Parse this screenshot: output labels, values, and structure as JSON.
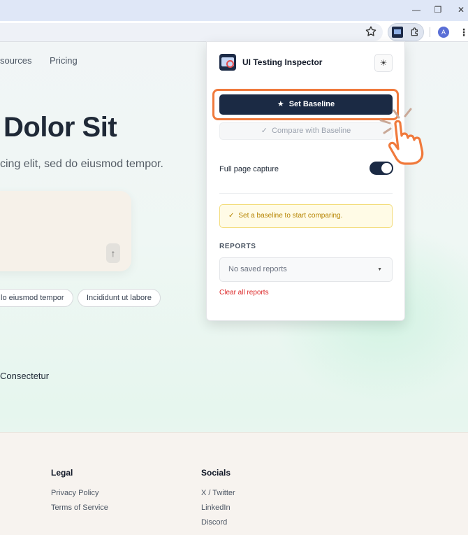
{
  "browser": {
    "window_controls": {
      "minimize": "—",
      "restore": "❐",
      "close": "✕"
    },
    "avatar_letter": "A"
  },
  "site": {
    "nav": [
      "sources",
      "Pricing"
    ],
    "hero_title": "Dolor Sit",
    "hero_subtitle": "cing elit, sed do eiusmod tempor.",
    "send_glyph": "↑",
    "chips": [
      "lo eiusmod tempor",
      "Incididunt ut labore"
    ],
    "link_text": "Consectetur",
    "footer": {
      "legal": {
        "heading": "Legal",
        "links": [
          "Privacy Policy",
          "Terms of Service"
        ]
      },
      "socials": {
        "heading": "Socials",
        "links": [
          "X / Twitter",
          "LinkedIn",
          "Discord"
        ]
      }
    }
  },
  "popup": {
    "title": "UI Testing Inspector",
    "theme_glyph": "☀",
    "set_baseline_label": "Set Baseline",
    "compare_label": "Compare with Baseline",
    "full_page_label": "Full page capture",
    "full_page_enabled": true,
    "alert_text": "Set a baseline to start comparing.",
    "reports_heading": "REPORTS",
    "reports_select_value": "No saved reports",
    "clear_label": "Clear all reports"
  },
  "colors": {
    "accent_dark": "#1b2a44",
    "highlight": "#f07a3c",
    "warning": "#b68400",
    "danger": "#dc2626"
  }
}
